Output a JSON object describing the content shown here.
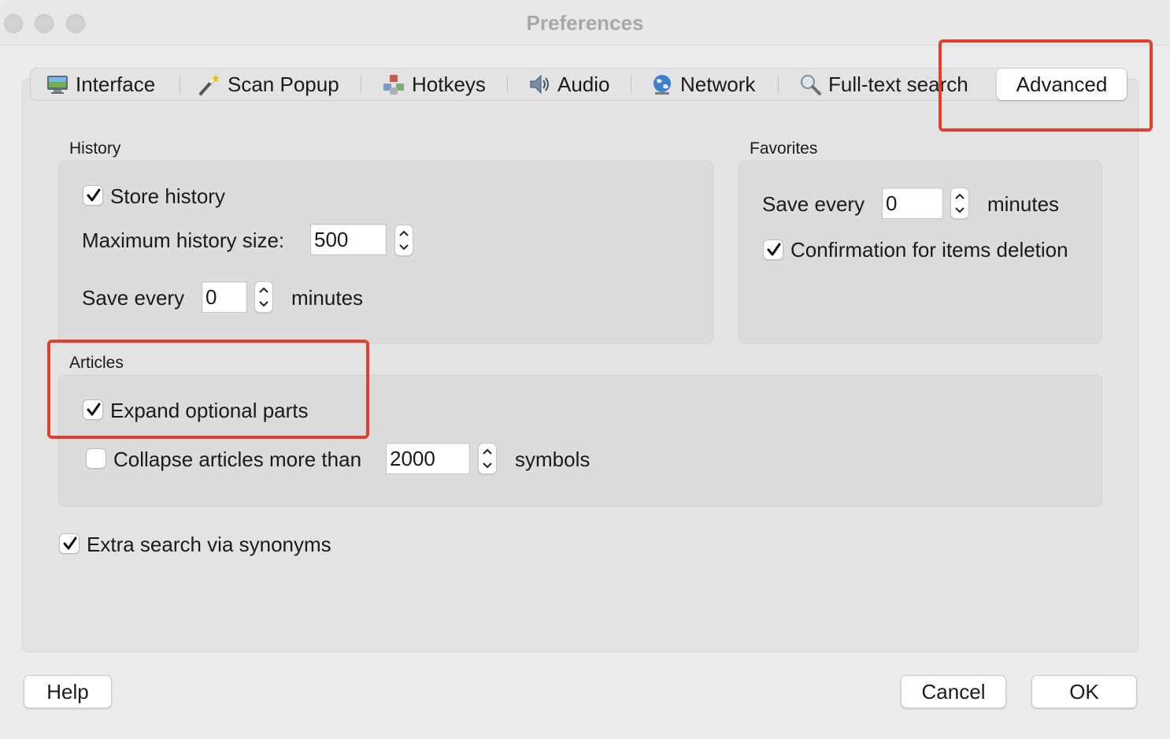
{
  "window": {
    "title": "Preferences"
  },
  "tabs": [
    {
      "label": "Interface",
      "icon": "monitor-icon"
    },
    {
      "label": "Scan Popup",
      "icon": "magic-wand-icon"
    },
    {
      "label": "Hotkeys",
      "icon": "hotkeys-icon"
    },
    {
      "label": "Audio",
      "icon": "speaker-icon"
    },
    {
      "label": "Network",
      "icon": "globe-icon"
    },
    {
      "label": "Full-text search",
      "icon": "magnifier-icon"
    },
    {
      "label": "Advanced",
      "icon": "",
      "selected": true
    }
  ],
  "history": {
    "label": "History",
    "store_history_label": "Store history",
    "store_history_checked": true,
    "max_size_label": "Maximum history size:",
    "max_size_value": "500",
    "save_every_label": "Save every",
    "save_every_value": "0",
    "save_every_unit": "minutes"
  },
  "favorites": {
    "label": "Favorites",
    "save_every_label": "Save every",
    "save_every_value": "0",
    "save_every_unit": "minutes",
    "confirm_label": "Confirmation for items deletion",
    "confirm_checked": true
  },
  "articles": {
    "label": "Articles",
    "expand_label": "Expand optional parts",
    "expand_checked": true,
    "collapse_label": "Collapse articles more than",
    "collapse_checked": false,
    "collapse_value": "2000",
    "collapse_unit": "symbols"
  },
  "extra_search": {
    "label": "Extra search via synonyms",
    "checked": true
  },
  "buttons": {
    "help": "Help",
    "cancel": "Cancel",
    "ok": "OK"
  },
  "colors": {
    "highlight": "#e2402f",
    "window_bg": "#ececec"
  }
}
